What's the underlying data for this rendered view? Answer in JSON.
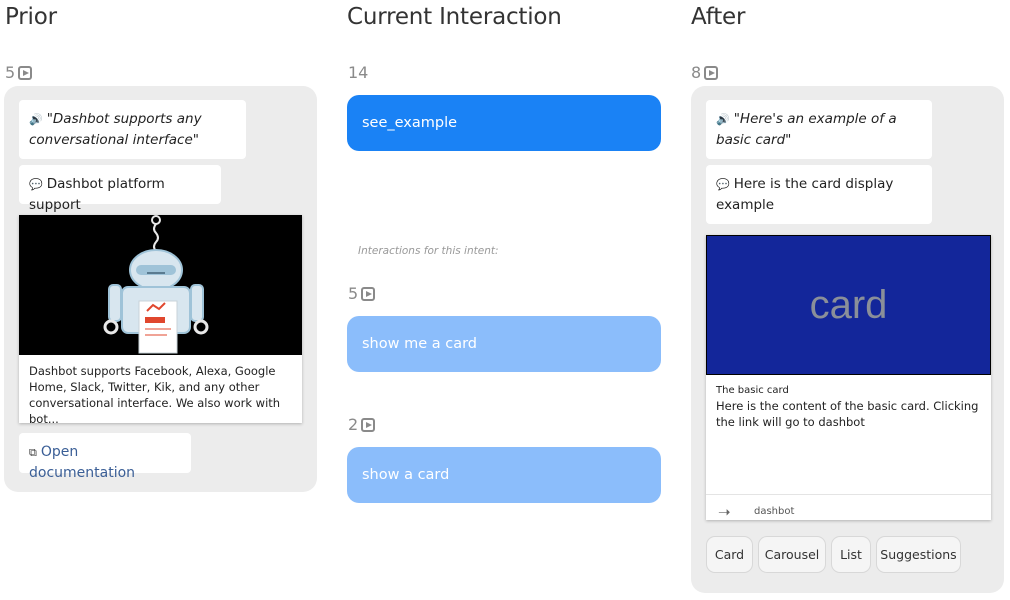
{
  "columns": {
    "prior": "Prior",
    "current": "Current Interaction",
    "after": "After"
  },
  "prior": {
    "count": "5",
    "speech": "\"Dashbot supports any conversational interface\"",
    "message": "Dashbot platform support",
    "card_description": "Dashbot supports Facebook, Alexa, Google Home, Slack, Twitter, Kik, and any other conversational interface. We also work with bot...",
    "link": "Open documentation"
  },
  "current": {
    "count": "14",
    "intent": "see_example",
    "note": "Interactions for this intent:",
    "similar": [
      {
        "count": "5",
        "label": "show me a card"
      },
      {
        "count": "2",
        "label": "show a card"
      }
    ]
  },
  "after": {
    "count": "8",
    "speech": "\"Here's an example of a basic card\"",
    "message": "Here is the card display example",
    "card_image_text": "card",
    "card_title": "The basic card",
    "card_body": "Here is the content of the basic card. Clicking the link will go to dashbot",
    "card_link": "dashbot",
    "chips": [
      "Card",
      "Carousel",
      "List",
      "Suggestions"
    ]
  },
  "colors": {
    "intent_current": "#1a82f5",
    "intent_similar": "#8bbdfb",
    "card_image_bg": "#13269a",
    "link": "#3a5e96"
  }
}
